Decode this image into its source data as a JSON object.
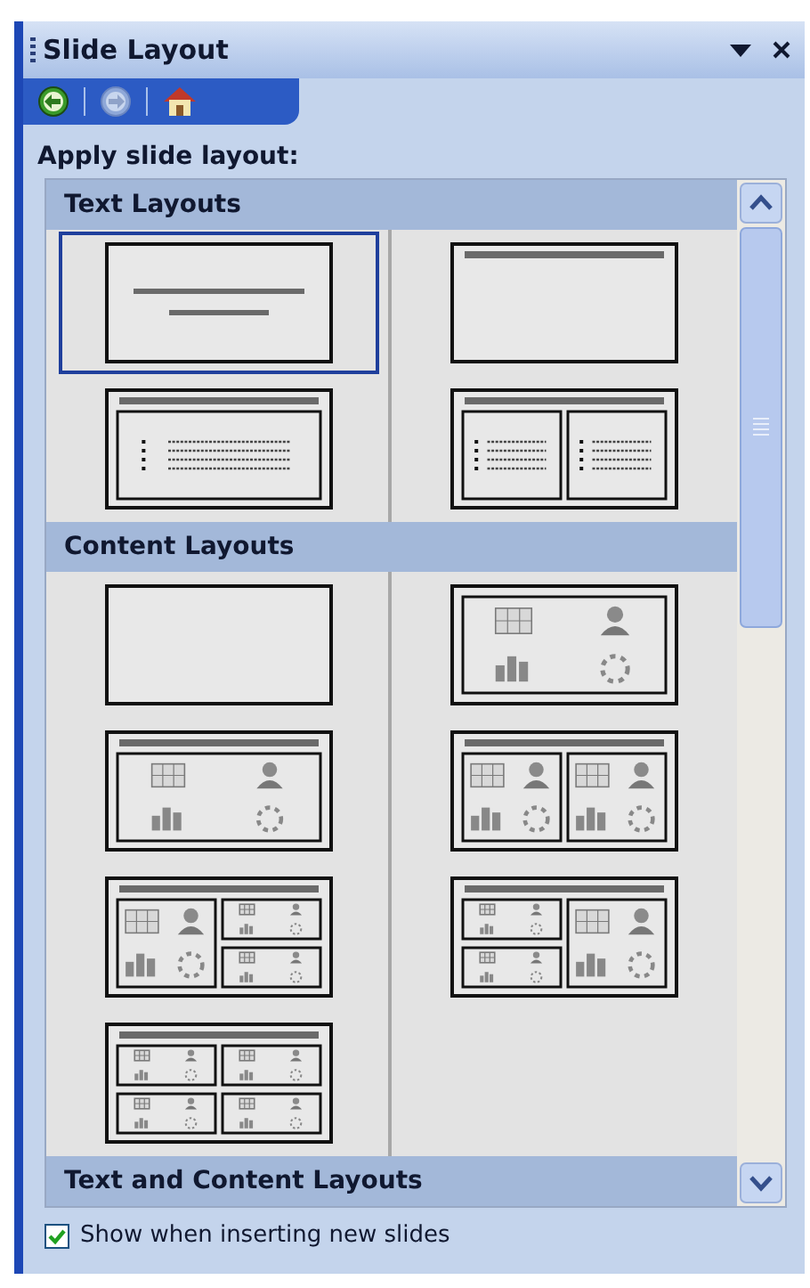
{
  "pane": {
    "title": "Slide Layout"
  },
  "heading": "Apply slide layout:",
  "sections": [
    {
      "title": "Text Layouts",
      "layouts": [
        {
          "kind": "title",
          "selected": true
        },
        {
          "kind": "title-only",
          "selected": false
        },
        {
          "kind": "title-text",
          "selected": false
        },
        {
          "kind": "two-text",
          "selected": false
        }
      ]
    },
    {
      "title": "Content Layouts",
      "layouts": [
        {
          "kind": "blank",
          "selected": false
        },
        {
          "kind": "content",
          "selected": false
        },
        {
          "kind": "title-content",
          "selected": false
        },
        {
          "kind": "two-content",
          "selected": false
        },
        {
          "kind": "content-two-small",
          "selected": false
        },
        {
          "kind": "two-small-content",
          "selected": false
        },
        {
          "kind": "four-content",
          "selected": false
        }
      ]
    },
    {
      "title": "Text and Content Layouts"
    }
  ],
  "show_on_insert": {
    "label": "Show when inserting new slides",
    "checked": true
  }
}
